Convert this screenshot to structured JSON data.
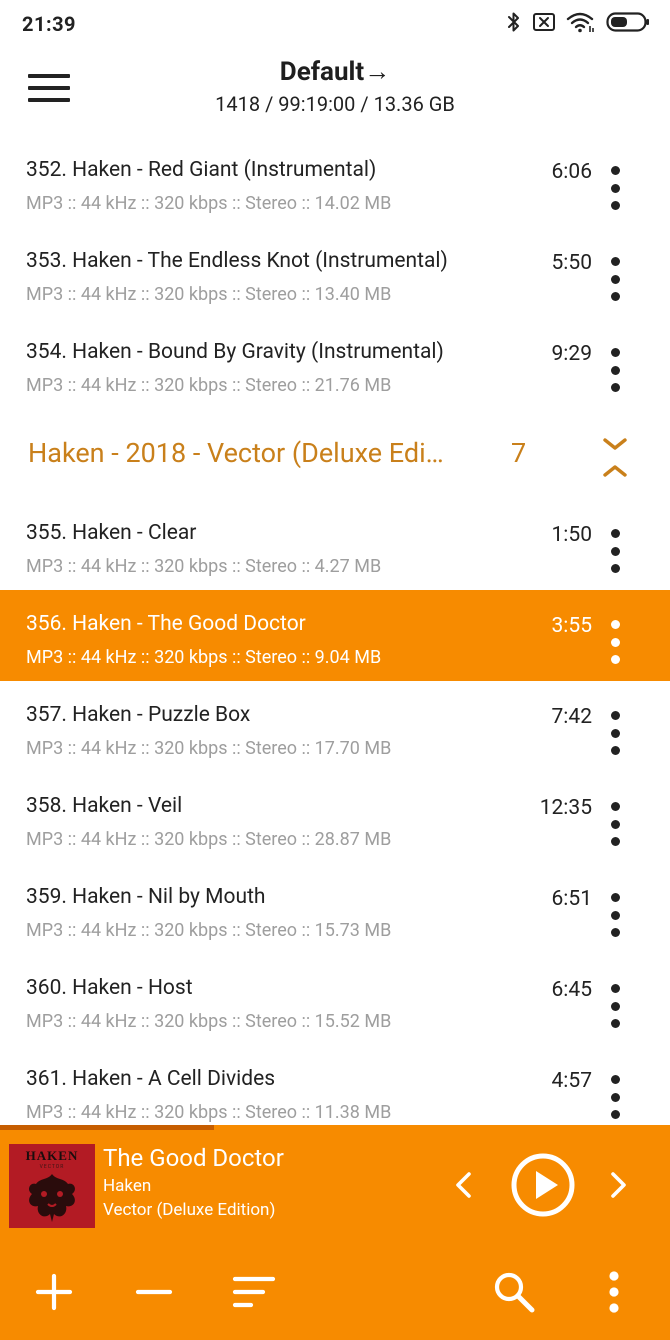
{
  "status_bar": {
    "time": "21:39"
  },
  "header": {
    "title": "Default→",
    "subtitle": "1418 / 99:19:00 / 13.36 GB"
  },
  "tracks_before": [
    {
      "title": "352. Haken - Red Giant (Instrumental)",
      "info": "MP3 :: 44 kHz :: 320 kbps :: Stereo :: 14.02 MB",
      "duration": "6:06"
    },
    {
      "title": "353. Haken - The Endless Knot (Instrumental)",
      "info": "MP3 :: 44 kHz :: 320 kbps :: Stereo :: 13.40 MB",
      "duration": "5:50"
    },
    {
      "title": "354. Haken - Bound By Gravity (Instrumental)",
      "info": "MP3 :: 44 kHz :: 320 kbps :: Stereo :: 21.76 MB",
      "duration": "9:29"
    }
  ],
  "group": {
    "title": "Haken - 2018 - Vector (Deluxe Edi…",
    "count": "7"
  },
  "tracks_after": [
    {
      "title": "355. Haken - Clear",
      "info": "MP3 :: 44 kHz :: 320 kbps :: Stereo :: 4.27 MB",
      "duration": "1:50"
    },
    {
      "title": "356. Haken - The Good Doctor",
      "info": "MP3 :: 44 kHz :: 320 kbps :: Stereo :: 9.04 MB",
      "duration": "3:55",
      "active": true
    },
    {
      "title": "357. Haken - Puzzle Box",
      "info": "MP3 :: 44 kHz :: 320 kbps :: Stereo :: 17.70 MB",
      "duration": "7:42"
    },
    {
      "title": "358. Haken - Veil",
      "info": "MP3 :: 44 kHz :: 320 kbps :: Stereo :: 28.87 MB",
      "duration": "12:35"
    },
    {
      "title": "359. Haken - Nil by Mouth",
      "info": "MP3 :: 44 kHz :: 320 kbps :: Stereo :: 15.73 MB",
      "duration": "6:51"
    },
    {
      "title": "360. Haken - Host",
      "info": "MP3 :: 44 kHz :: 320 kbps :: Stereo :: 15.52 MB",
      "duration": "6:45"
    },
    {
      "title": "361. Haken - A Cell Divides",
      "info": "MP3 :: 44 kHz :: 320 kbps :: Stereo :: 11.38 MB",
      "duration": "4:57"
    }
  ],
  "player": {
    "title": "The Good Doctor",
    "artist": "Haken",
    "album": "Vector (Deluxe Edition)",
    "album_art_text": "HAKEN",
    "album_art_subtext": "VECTOR",
    "progress": 0.32
  },
  "toolbar": {
    "icons": [
      "add-icon",
      "remove-icon",
      "sort-icon",
      "search-icon",
      "more-vert-icon"
    ]
  },
  "colors": {
    "accent": "#f78b00",
    "group_header": "#c9801b",
    "secondary_text": "#9e9e9e",
    "album_art": "#b31b24"
  }
}
